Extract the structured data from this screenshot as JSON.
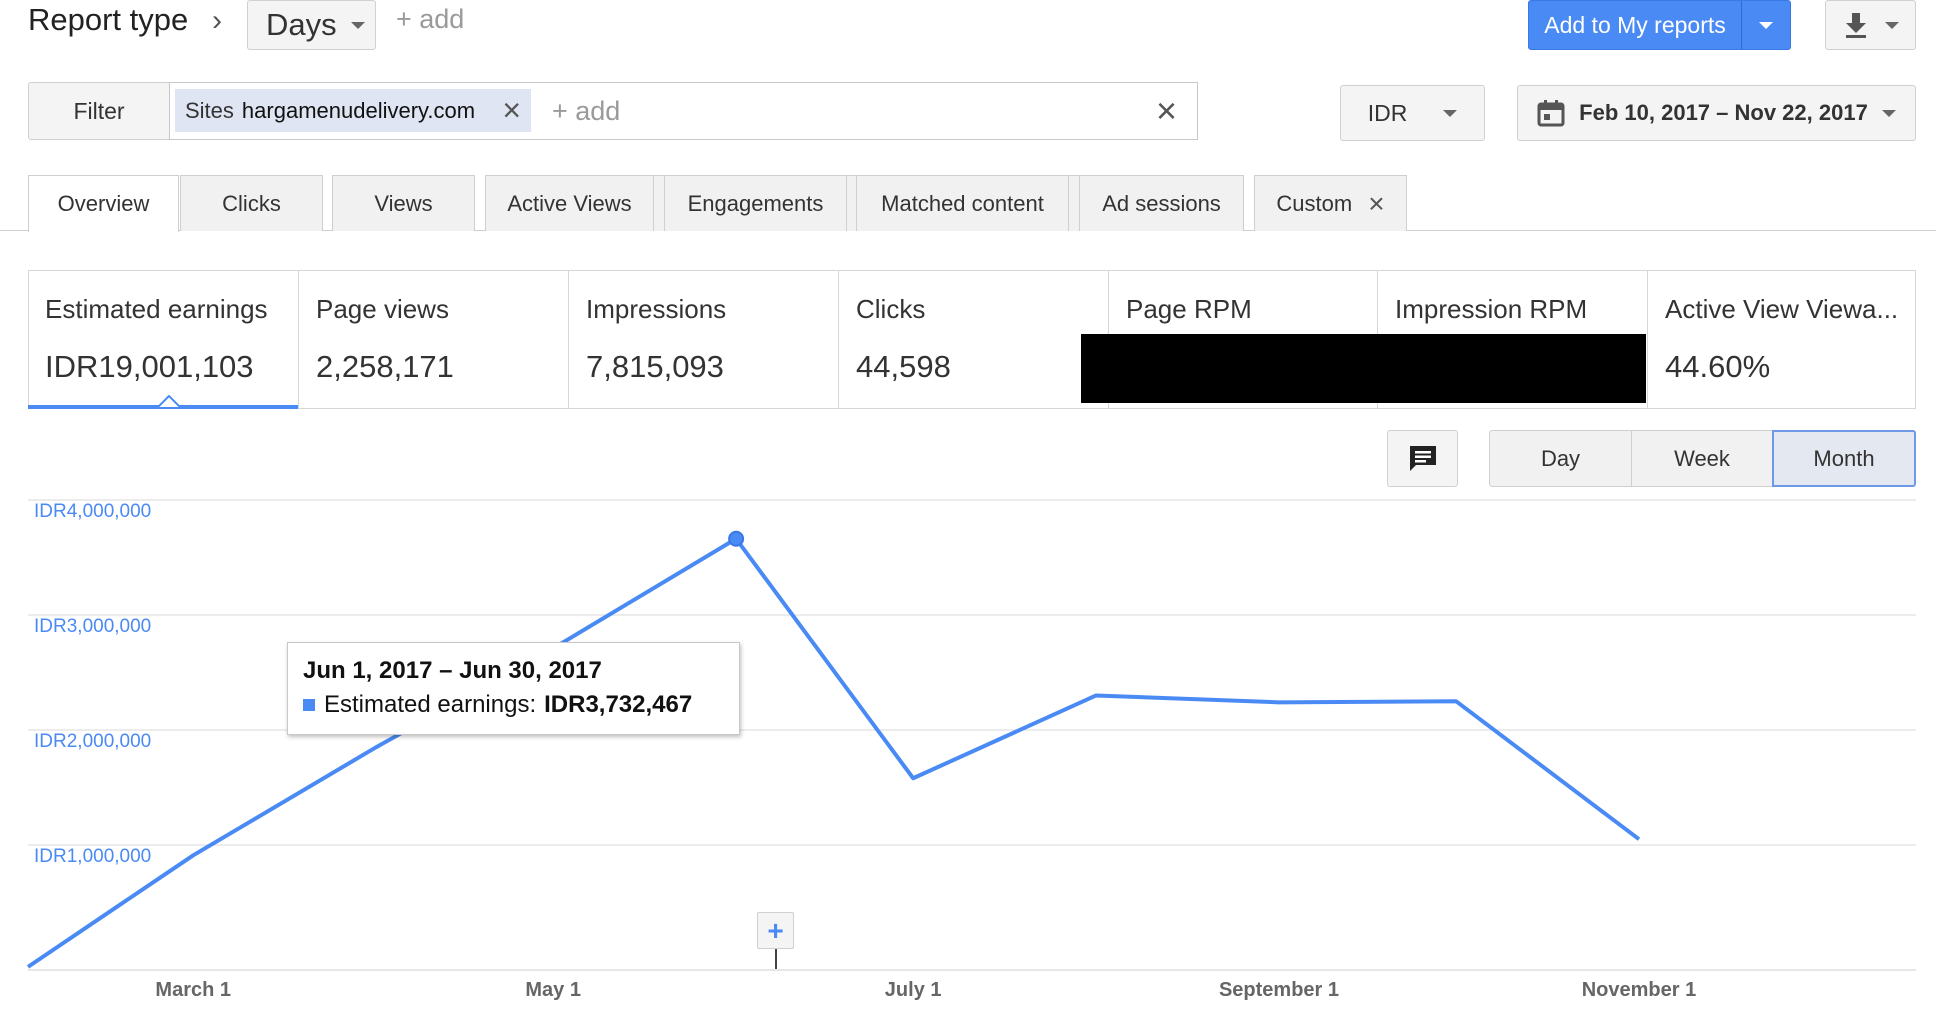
{
  "header": {
    "report_type_label": "Report type",
    "dimension_value": "Days",
    "add_label": "+ add",
    "add_to_reports_label": "Add to My reports"
  },
  "filter": {
    "button_label": "Filter",
    "chip_key": "Sites",
    "chip_value": "hargamenudelivery.com",
    "add_label": "+ add",
    "currency": "IDR",
    "date_range": "Feb 10, 2017 – Nov 22, 2017"
  },
  "tabs": [
    {
      "label": "Overview",
      "active": true
    },
    {
      "label": "Clicks"
    },
    {
      "label": "Views"
    },
    {
      "label": "Active Views"
    },
    {
      "label": "Engagements"
    },
    {
      "label": "Matched content"
    },
    {
      "label": "Ad sessions"
    },
    {
      "label": "Custom"
    }
  ],
  "metrics": [
    {
      "label": "Estimated earnings",
      "value": "IDR19,001,103",
      "active": true
    },
    {
      "label": "Page views",
      "value": "2,258,171"
    },
    {
      "label": "Impressions",
      "value": "7,815,093"
    },
    {
      "label": "Clicks",
      "value": "44,598"
    },
    {
      "label": "Page RPM",
      "value": ""
    },
    {
      "label": "Impression RPM",
      "value": ""
    },
    {
      "label": "Active View Viewa...",
      "value": "44.60%"
    }
  ],
  "granularity": {
    "options": [
      "Day",
      "Week",
      "Month"
    ],
    "selected": "Month"
  },
  "icons": {
    "breadcrumb": "chevron-right-icon",
    "download": "download-icon",
    "calendar": "calendar-icon",
    "annotation": "comment-icon",
    "add_annotation": "plus-icon"
  },
  "colors": {
    "accent": "#4a8af4",
    "series": "#4a8af4",
    "axis_label": "#4a8af4"
  },
  "tooltip": {
    "title": "Jun 1, 2017 – Jun 30, 2017",
    "series_label": "Estimated earnings:",
    "value": "IDR3,732,467"
  },
  "chart_data": {
    "type": "line",
    "title": "",
    "xlabel": "",
    "ylabel": "",
    "y_tick_labels": [
      "IDR1,000,000",
      "IDR2,000,000",
      "IDR3,000,000",
      "IDR4,000,000"
    ],
    "y_ticks": [
      1000000,
      2000000,
      3000000,
      4000000
    ],
    "ylim": [
      0,
      4000000
    ],
    "x_tick_labels": [
      "March 1",
      "May 1",
      "July 1",
      "September 1",
      "November 1"
    ],
    "x_ticks": [
      "2017-03-01",
      "2017-05-01",
      "2017-07-01",
      "2017-09-01",
      "2017-11-01"
    ],
    "xlim": [
      "2017-02-01",
      "2017-12-01"
    ],
    "grid": true,
    "series": [
      {
        "name": "Estimated earnings",
        "x": [
          "2017-02-01",
          "2017-03-01",
          "2017-04-01",
          "2017-05-01",
          "2017-06-01",
          "2017-07-01",
          "2017-08-01",
          "2017-09-01",
          "2017-10-01",
          "2017-11-01"
        ],
        "y": [
          10000,
          980000,
          1920000,
          2780000,
          3732467,
          1650000,
          2370000,
          2310000,
          2320000,
          1120000
        ]
      }
    ],
    "highlighted_point": "2017-06-01"
  }
}
